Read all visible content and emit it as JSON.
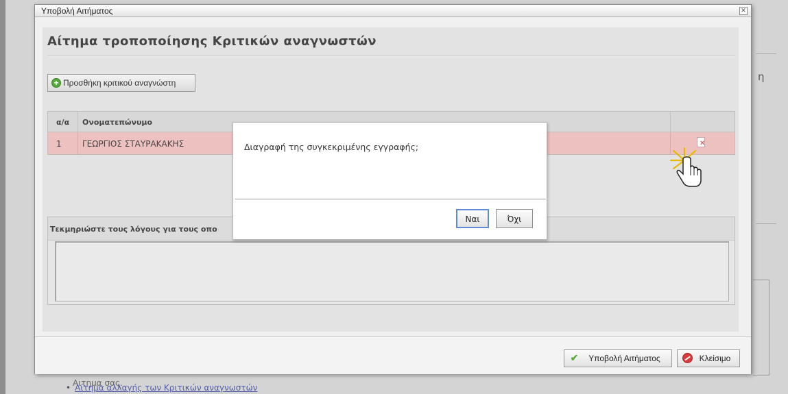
{
  "background": {
    "side_text": "η",
    "fragment_text": "Αιτημα σας.",
    "link_bullet": "•",
    "link_text": "Αίτημα αλλαγής των Κριτικών αναγνωστών"
  },
  "window": {
    "title": "Υποβολή Αιτήματος",
    "close_glyph": "✕"
  },
  "page": {
    "title": "Αίτημα τροποποίησης Κριτικών αναγνωστών",
    "add_button_label": "Προσθήκη κριτικού αναγνώστη",
    "add_icon_glyph": "+"
  },
  "table": {
    "columns": [
      "α/α",
      "Ονοματεπώνυμο",
      ""
    ],
    "rows": [
      {
        "aa": "1",
        "name": "ΓΕΩΡΓΙΟΣ ΣΤΑΥΡΑΚΑΚΗΣ"
      }
    ]
  },
  "justification": {
    "label": "Τεκμηριώστε τους λόγους για τους οπο"
  },
  "footer": {
    "submit_label": "Υποβολή Αιτήματος",
    "close_label": "Κλείσιμο",
    "check_glyph": "✔"
  },
  "confirm": {
    "message": "Διαγραφή της συγκεκριμένης εγγραφής;",
    "yes_label": "Ναι",
    "no_label": "Όχι"
  },
  "colors": {
    "selected_row": "#eec1c1",
    "primary_focus": "#5e8bd3",
    "add_green": "#54a83a",
    "close_red": "#d93a3a"
  },
  "icons": {
    "add": "plus-circle-icon",
    "delete": "delete-record-icon",
    "cursor": "hand-pointer-icon",
    "submit": "checkmark-icon",
    "close": "no-entry-icon"
  }
}
